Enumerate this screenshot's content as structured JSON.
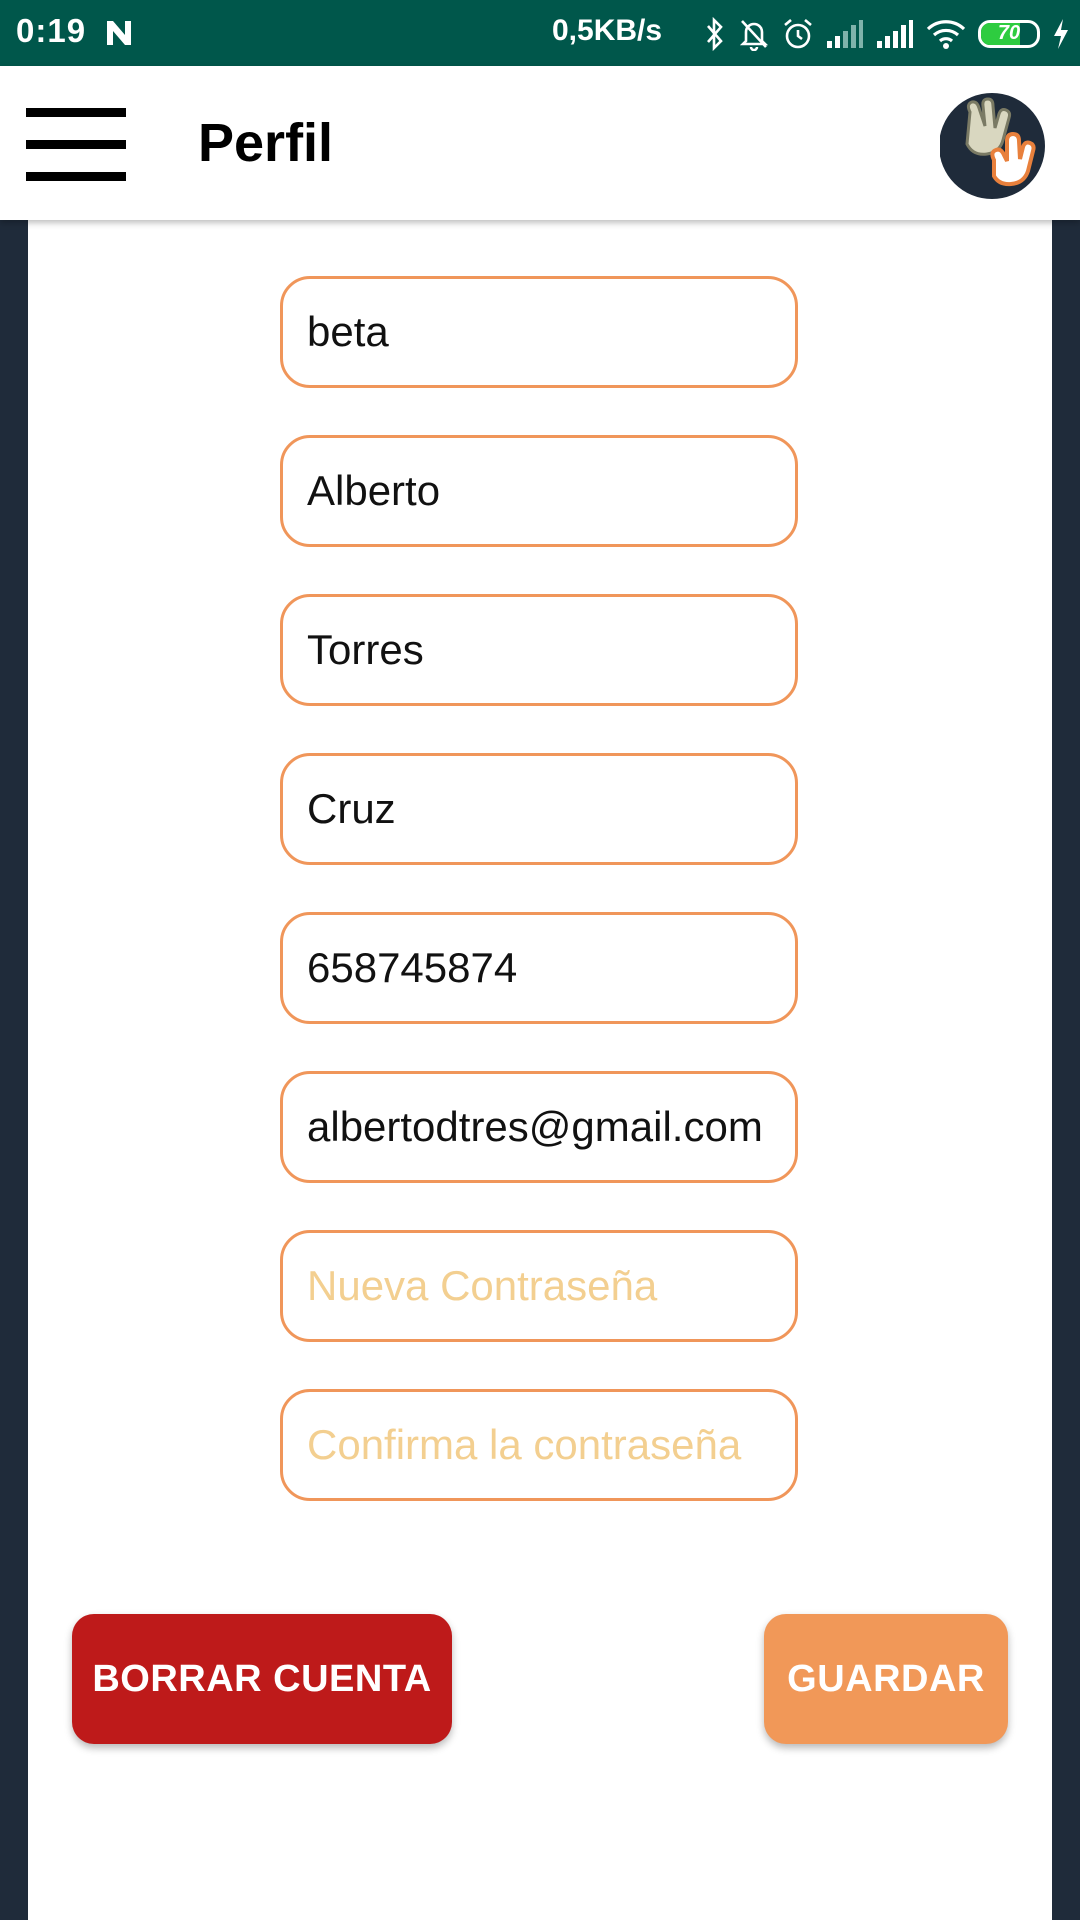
{
  "status_bar": {
    "time": "0:19",
    "network_speed": "0,5KB/s",
    "battery_level": 70,
    "battery_text": "70",
    "background_color": "#00574b"
  },
  "app_bar": {
    "title": "Perfil",
    "menu_icon": "hamburger-menu-icon",
    "logo_icon": "hands-logo"
  },
  "form": {
    "fields": [
      {
        "value": "beta",
        "placeholder": ""
      },
      {
        "value": "Alberto",
        "placeholder": ""
      },
      {
        "value": "Torres",
        "placeholder": ""
      },
      {
        "value": "Cruz",
        "placeholder": ""
      },
      {
        "value": "658745874",
        "placeholder": ""
      },
      {
        "value": "albertodtres@gmail.com",
        "placeholder": ""
      },
      {
        "value": "",
        "placeholder": "Nueva Contraseña"
      },
      {
        "value": "",
        "placeholder": "Confirma la contraseña"
      }
    ],
    "border_color": "#f0965a",
    "placeholder_color": "#f3cf90"
  },
  "actions": {
    "delete_label": "BORRAR CUENTA",
    "save_label": "GUARDAR",
    "delete_color": "#be1a1a",
    "save_color": "#f19858"
  }
}
